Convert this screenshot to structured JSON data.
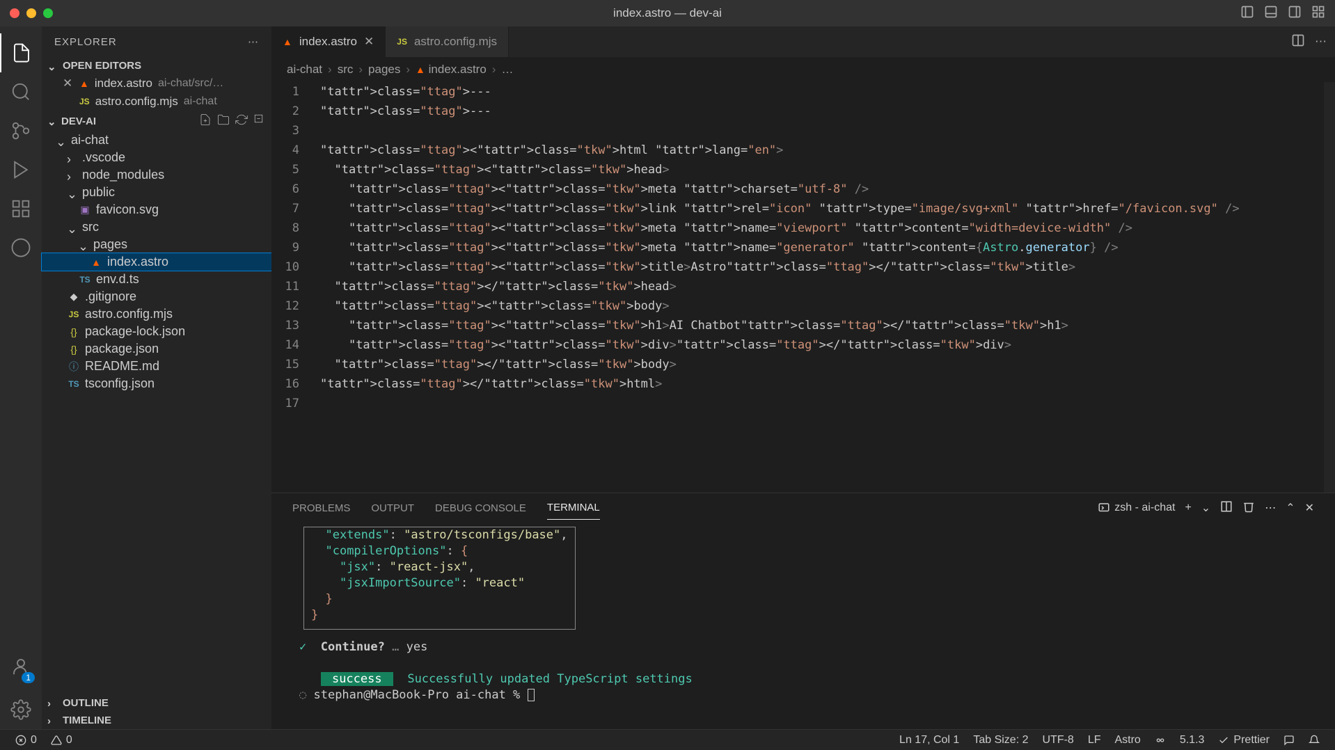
{
  "window": {
    "title": "index.astro — dev-ai"
  },
  "explorer": {
    "label": "EXPLORER",
    "openEditors": {
      "label": "OPEN EDITORS",
      "items": [
        {
          "name": "index.astro",
          "hint": "ai-chat/src/…",
          "modified": true
        },
        {
          "name": "astro.config.mjs",
          "hint": "ai-chat",
          "modified": false
        }
      ]
    },
    "project": {
      "name": "DEV-AI",
      "tree": [
        {
          "depth": 1,
          "kind": "folder",
          "open": true,
          "name": "ai-chat"
        },
        {
          "depth": 2,
          "kind": "folder",
          "open": false,
          "name": ".vscode"
        },
        {
          "depth": 2,
          "kind": "folder",
          "open": false,
          "name": "node_modules"
        },
        {
          "depth": 2,
          "kind": "folder",
          "open": true,
          "name": "public"
        },
        {
          "depth": 3,
          "kind": "file",
          "icon": "svg",
          "name": "favicon.svg"
        },
        {
          "depth": 2,
          "kind": "folder",
          "open": true,
          "name": "src"
        },
        {
          "depth": 3,
          "kind": "folder",
          "open": true,
          "name": "pages"
        },
        {
          "depth": 4,
          "kind": "file",
          "icon": "astro",
          "name": "index.astro",
          "selected": true
        },
        {
          "depth": 3,
          "kind": "file",
          "icon": "ts",
          "name": "env.d.ts"
        },
        {
          "depth": 2,
          "kind": "file",
          "icon": "",
          "name": ".gitignore"
        },
        {
          "depth": 2,
          "kind": "file",
          "icon": "js",
          "name": "astro.config.mjs"
        },
        {
          "depth": 2,
          "kind": "file",
          "icon": "json",
          "name": "package-lock.json"
        },
        {
          "depth": 2,
          "kind": "file",
          "icon": "json",
          "name": "package.json"
        },
        {
          "depth": 2,
          "kind": "file",
          "icon": "md",
          "name": "README.md"
        },
        {
          "depth": 2,
          "kind": "file",
          "icon": "ts",
          "name": "tsconfig.json"
        }
      ]
    },
    "outline": "OUTLINE",
    "timeline": "TIMELINE"
  },
  "tabs": [
    {
      "name": "index.astro",
      "active": true,
      "icon": "astro"
    },
    {
      "name": "astro.config.mjs",
      "active": false,
      "icon": "js"
    }
  ],
  "breadcrumb": [
    "ai-chat",
    "src",
    "pages",
    "index.astro",
    "…"
  ],
  "editor": {
    "lines": [
      "---",
      "---",
      "",
      "<html lang=\"en\">",
      "  <head>",
      "    <meta charset=\"utf-8\" />",
      "    <link rel=\"icon\" type=\"image/svg+xml\" href=\"/favicon.svg\" />",
      "    <meta name=\"viewport\" content=\"width=device-width\" />",
      "    <meta name=\"generator\" content={Astro.generator} />",
      "    <title>Astro</title>",
      "  </head>",
      "  <body>",
      "    <h1>AI Chatbot</h1>",
      "    <div></div>",
      "  </body>",
      "</html>",
      ""
    ]
  },
  "panel": {
    "tabs": [
      "PROBLEMS",
      "OUTPUT",
      "DEBUG CONSOLE",
      "TERMINAL"
    ],
    "activeTab": "TERMINAL",
    "shell": "zsh - ai-chat",
    "terminal": {
      "json_lines": [
        "  \"extends\": \"astro/tsconfigs/base\",",
        "  \"compilerOptions\": {",
        "    \"jsx\": \"react-jsx\",",
        "    \"jsxImportSource\": \"react\"",
        "  }",
        "}"
      ],
      "continue_prompt": "Continue?",
      "continue_answer": "yes",
      "success_label": "success",
      "success_msg": "Successfully updated TypeScript settings",
      "prompt": "stephan@MacBook-Pro ai-chat %"
    }
  },
  "statusbar": {
    "errors": "0",
    "warnings": "0",
    "cursor": "Ln 17, Col 1",
    "tabsize": "Tab Size: 2",
    "encoding": "UTF-8",
    "eol": "LF",
    "language": "Astro",
    "version": "5.1.3",
    "prettier": "Prettier"
  }
}
